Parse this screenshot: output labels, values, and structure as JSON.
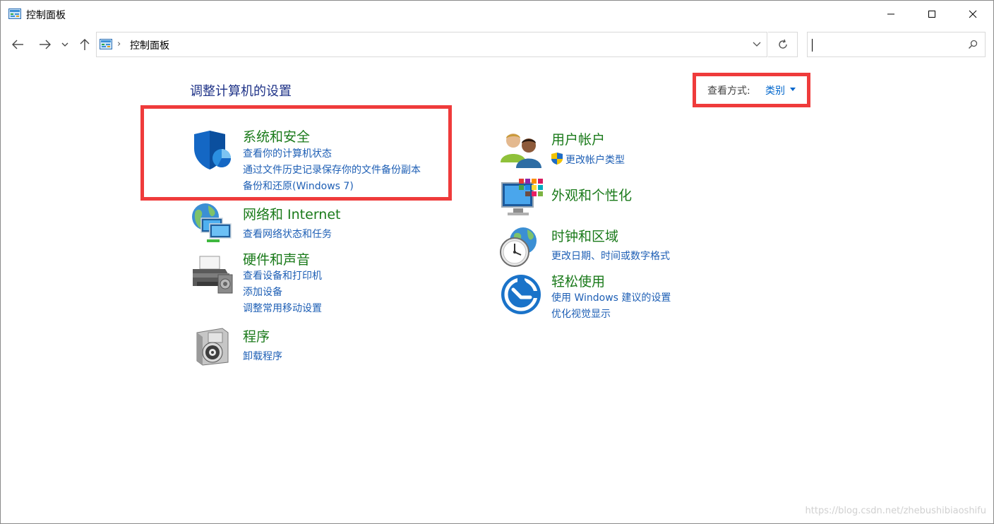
{
  "window": {
    "title": "控制面板"
  },
  "address": {
    "crumb": "控制面板",
    "separator": "›"
  },
  "search": {
    "value": "",
    "placeholder": ""
  },
  "content": {
    "heading": "调整计算机的设置",
    "view_by_label": "查看方式:",
    "view_by_value": "类别"
  },
  "categories_left": [
    {
      "title": "系统和安全",
      "links": [
        "查看你的计算机状态",
        "通过文件历史记录保存你的文件备份副本",
        "备份和还原(Windows 7)"
      ],
      "icon": "shield-icon"
    },
    {
      "title": "网络和 Internet",
      "links": [
        "查看网络状态和任务"
      ],
      "icon": "network-globe-icon"
    },
    {
      "title": "硬件和声音",
      "links": [
        "查看设备和打印机",
        "添加设备",
        "调整常用移动设置"
      ],
      "icon": "printer-icon"
    },
    {
      "title": "程序",
      "links": [
        "卸载程序"
      ],
      "icon": "programs-disc-icon"
    }
  ],
  "categories_right": [
    {
      "title": "用户帐户",
      "links": [
        "更改帐户类型"
      ],
      "icon": "users-icon"
    },
    {
      "title": "外观和个性化",
      "links": [],
      "icon": "appearance-monitor-icon"
    },
    {
      "title": "时钟和区域",
      "links": [
        "更改日期、时间或数字格式"
      ],
      "icon": "clock-globe-icon"
    },
    {
      "title": "轻松使用",
      "links": [
        "使用 Windows 建议的设置",
        "优化视觉显示"
      ],
      "icon": "ease-of-access-icon"
    }
  ],
  "watermark": "https://blog.csdn.net/zhebushibiaoshifu",
  "colors": {
    "highlight": "#ef3b3b",
    "link": "#1e5fb5",
    "title": "#1a7a1a",
    "heading": "#1e3287"
  }
}
